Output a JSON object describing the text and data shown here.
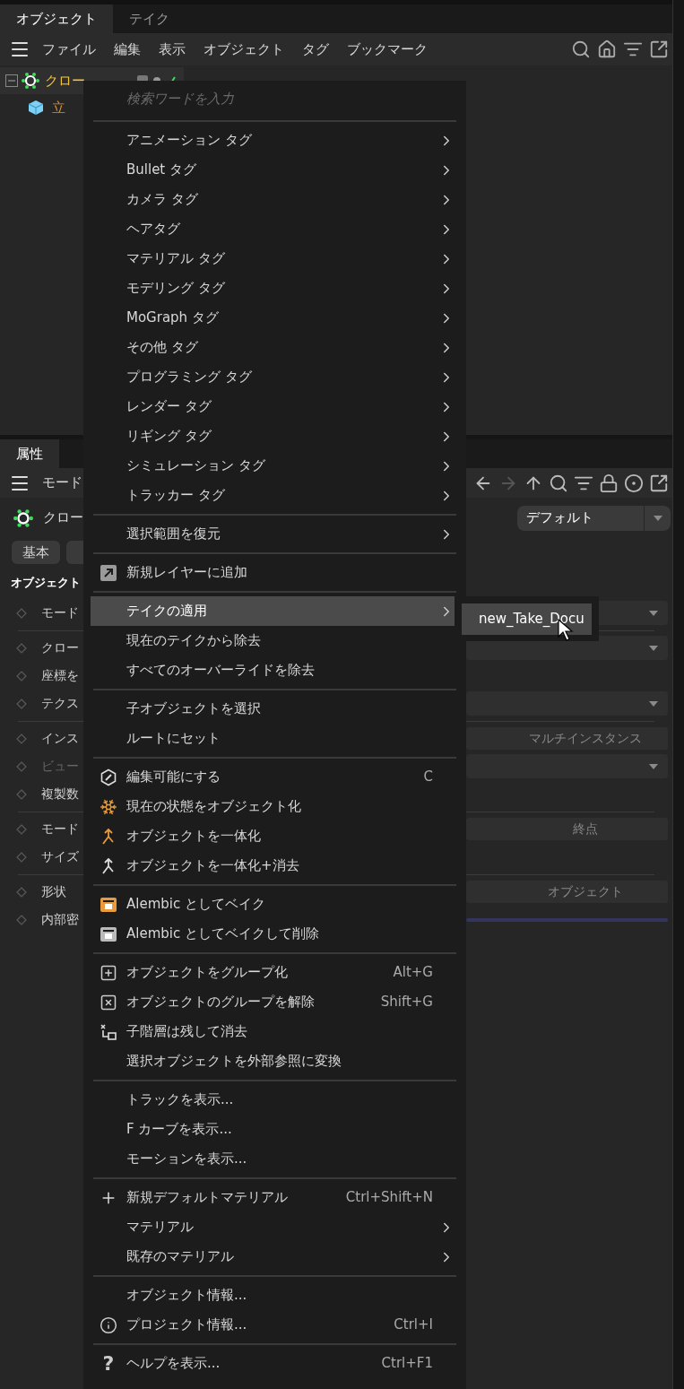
{
  "object_manager": {
    "tabs": [
      {
        "label": "オブジェクト",
        "selected": true
      },
      {
        "label": "テイク",
        "selected": false
      }
    ],
    "menu_bar": [
      "ファイル",
      "編集",
      "表示",
      "オブジェクト",
      "タグ",
      "ブックマーク"
    ],
    "tree": [
      {
        "label": "クロー",
        "expanded": true,
        "children": [
          {
            "label": "立"
          }
        ]
      }
    ]
  },
  "attributes": {
    "tabs": [
      {
        "label": "属性",
        "selected": true
      }
    ],
    "mode_menu": "モード",
    "object_name": "クロー",
    "preset": "デフォルト",
    "mode_buttons": [
      {
        "label": "基本",
        "selected": false
      }
    ],
    "section_title": "オブジェクト",
    "rows": [
      {
        "kind": "row",
        "label": "モード",
        "disabled": false,
        "control": {
          "kind": "dropdown"
        }
      },
      {
        "kind": "separator"
      },
      {
        "kind": "row",
        "label": "クロー",
        "disabled": false,
        "control": {
          "kind": "dropdown"
        }
      },
      {
        "kind": "row",
        "label": "座標を",
        "disabled": false
      },
      {
        "kind": "row",
        "label": "テクス",
        "disabled": false,
        "control": {
          "kind": "dropdown"
        }
      },
      {
        "kind": "separator"
      },
      {
        "kind": "row",
        "label": "インス",
        "disabled": false,
        "control": {
          "kind": "button",
          "text": "マルチインスタンス"
        }
      },
      {
        "kind": "row",
        "label": "ビュー",
        "disabled": true,
        "control": {
          "kind": "dropdown"
        }
      },
      {
        "kind": "row",
        "label": "複製数",
        "disabled": false
      },
      {
        "kind": "separator"
      },
      {
        "kind": "row",
        "label": "モード",
        "disabled": false,
        "control": {
          "kind": "button",
          "text": "終点"
        }
      },
      {
        "kind": "row",
        "label": "サイズ",
        "disabled": false
      },
      {
        "kind": "separator"
      },
      {
        "kind": "row",
        "label": "形状",
        "disabled": false,
        "control": {
          "kind": "button",
          "text": "オブジェクト"
        }
      },
      {
        "kind": "row",
        "label": "内部密",
        "disabled": false,
        "control": {
          "kind": "bar"
        }
      }
    ]
  },
  "context_menu": {
    "search_placeholder": "検索ワードを入力",
    "items": [
      {
        "kind": "item",
        "label": "アニメーション タグ",
        "submenu": true,
        "selected": false
      },
      {
        "kind": "item",
        "label": "Bullet タグ",
        "submenu": true,
        "selected": false
      },
      {
        "kind": "item",
        "label": "カメラ タグ",
        "submenu": true,
        "selected": false
      },
      {
        "kind": "item",
        "label": "ヘアタグ",
        "submenu": true,
        "selected": false
      },
      {
        "kind": "item",
        "label": "マテリアル タグ",
        "submenu": true,
        "selected": false
      },
      {
        "kind": "item",
        "label": "モデリング タグ",
        "submenu": true,
        "selected": false
      },
      {
        "kind": "item",
        "label": "MoGraph タグ",
        "submenu": true,
        "selected": false
      },
      {
        "kind": "item",
        "label": "その他 タグ",
        "submenu": true,
        "selected": false
      },
      {
        "kind": "item",
        "label": "プログラミング タグ",
        "submenu": true,
        "selected": false
      },
      {
        "kind": "item",
        "label": "レンダー タグ",
        "submenu": true,
        "selected": false
      },
      {
        "kind": "item",
        "label": "リギング タグ",
        "submenu": true,
        "selected": false
      },
      {
        "kind": "item",
        "label": "シミュレーション タグ",
        "submenu": true,
        "selected": false
      },
      {
        "kind": "item",
        "label": "トラッカー タグ",
        "submenu": true,
        "selected": false
      },
      {
        "kind": "separator"
      },
      {
        "kind": "item",
        "label": "選択範囲を復元",
        "submenu": true,
        "selected": false
      },
      {
        "kind": "separator"
      },
      {
        "kind": "item",
        "label": "新規レイヤーに追加",
        "submenu": false,
        "selected": false
      },
      {
        "kind": "separator"
      },
      {
        "kind": "item",
        "label": "テイクの適用",
        "submenu": true,
        "selected": true
      },
      {
        "kind": "item",
        "label": "現在のテイクから除去",
        "submenu": false,
        "selected": false
      },
      {
        "kind": "item",
        "label": "すべてのオーバーライドを除去",
        "submenu": false,
        "selected": false
      },
      {
        "kind": "separator"
      },
      {
        "kind": "item",
        "label": "子オブジェクトを選択",
        "submenu": false,
        "selected": false
      },
      {
        "kind": "item",
        "label": "ルートにセット",
        "submenu": false,
        "selected": false
      },
      {
        "kind": "separator"
      },
      {
        "kind": "item",
        "label": "編集可能にする",
        "shortcut": "C",
        "submenu": false,
        "selected": false
      },
      {
        "kind": "item",
        "label": "現在の状態をオブジェクト化",
        "submenu": false,
        "selected": false
      },
      {
        "kind": "item",
        "label": "オブジェクトを一体化",
        "submenu": false,
        "selected": false
      },
      {
        "kind": "item",
        "label": "オブジェクトを一体化+消去",
        "submenu": false,
        "selected": false
      },
      {
        "kind": "separator"
      },
      {
        "kind": "item",
        "label": "Alembic としてベイク",
        "submenu": false,
        "selected": false
      },
      {
        "kind": "item",
        "label": "Alembic としてベイクして削除",
        "submenu": false,
        "selected": false
      },
      {
        "kind": "separator"
      },
      {
        "kind": "item",
        "label": "オブジェクトをグループ化",
        "shortcut": "Alt+G",
        "submenu": false,
        "selected": false
      },
      {
        "kind": "item",
        "label": "オブジェクトのグループを解除",
        "shortcut": "Shift+G",
        "submenu": false,
        "selected": false
      },
      {
        "kind": "item",
        "label": "子階層は残して消去",
        "submenu": false,
        "selected": false
      },
      {
        "kind": "item",
        "label": "選択オブジェクトを外部参照に変換",
        "submenu": false,
        "selected": false
      },
      {
        "kind": "separator"
      },
      {
        "kind": "item",
        "label": "トラックを表示...",
        "submenu": false,
        "selected": false
      },
      {
        "kind": "item",
        "label": "F カーブを表示...",
        "submenu": false,
        "selected": false
      },
      {
        "kind": "item",
        "label": "モーションを表示...",
        "submenu": false,
        "selected": false
      },
      {
        "kind": "separator"
      },
      {
        "kind": "item",
        "label": "新規デフォルトマテリアル",
        "shortcut": "Ctrl+Shift+N",
        "submenu": false,
        "selected": false
      },
      {
        "kind": "item",
        "label": "マテリアル",
        "submenu": true,
        "selected": false
      },
      {
        "kind": "item",
        "label": "既存のマテリアル",
        "submenu": true,
        "selected": false
      },
      {
        "kind": "separator"
      },
      {
        "kind": "item",
        "label": "オブジェクト情報...",
        "submenu": false,
        "selected": false
      },
      {
        "kind": "item",
        "label": "プロジェクト情報...",
        "shortcut": "Ctrl+I",
        "submenu": false,
        "selected": false
      },
      {
        "kind": "separator"
      },
      {
        "kind": "item",
        "label": "ヘルプを表示...",
        "glyph": "?",
        "shortcut": "Ctrl+F1",
        "submenu": false,
        "selected": false
      }
    ]
  },
  "submenu": {
    "items": [
      {
        "label": "new_Take_Docu",
        "selected": true
      }
    ]
  }
}
